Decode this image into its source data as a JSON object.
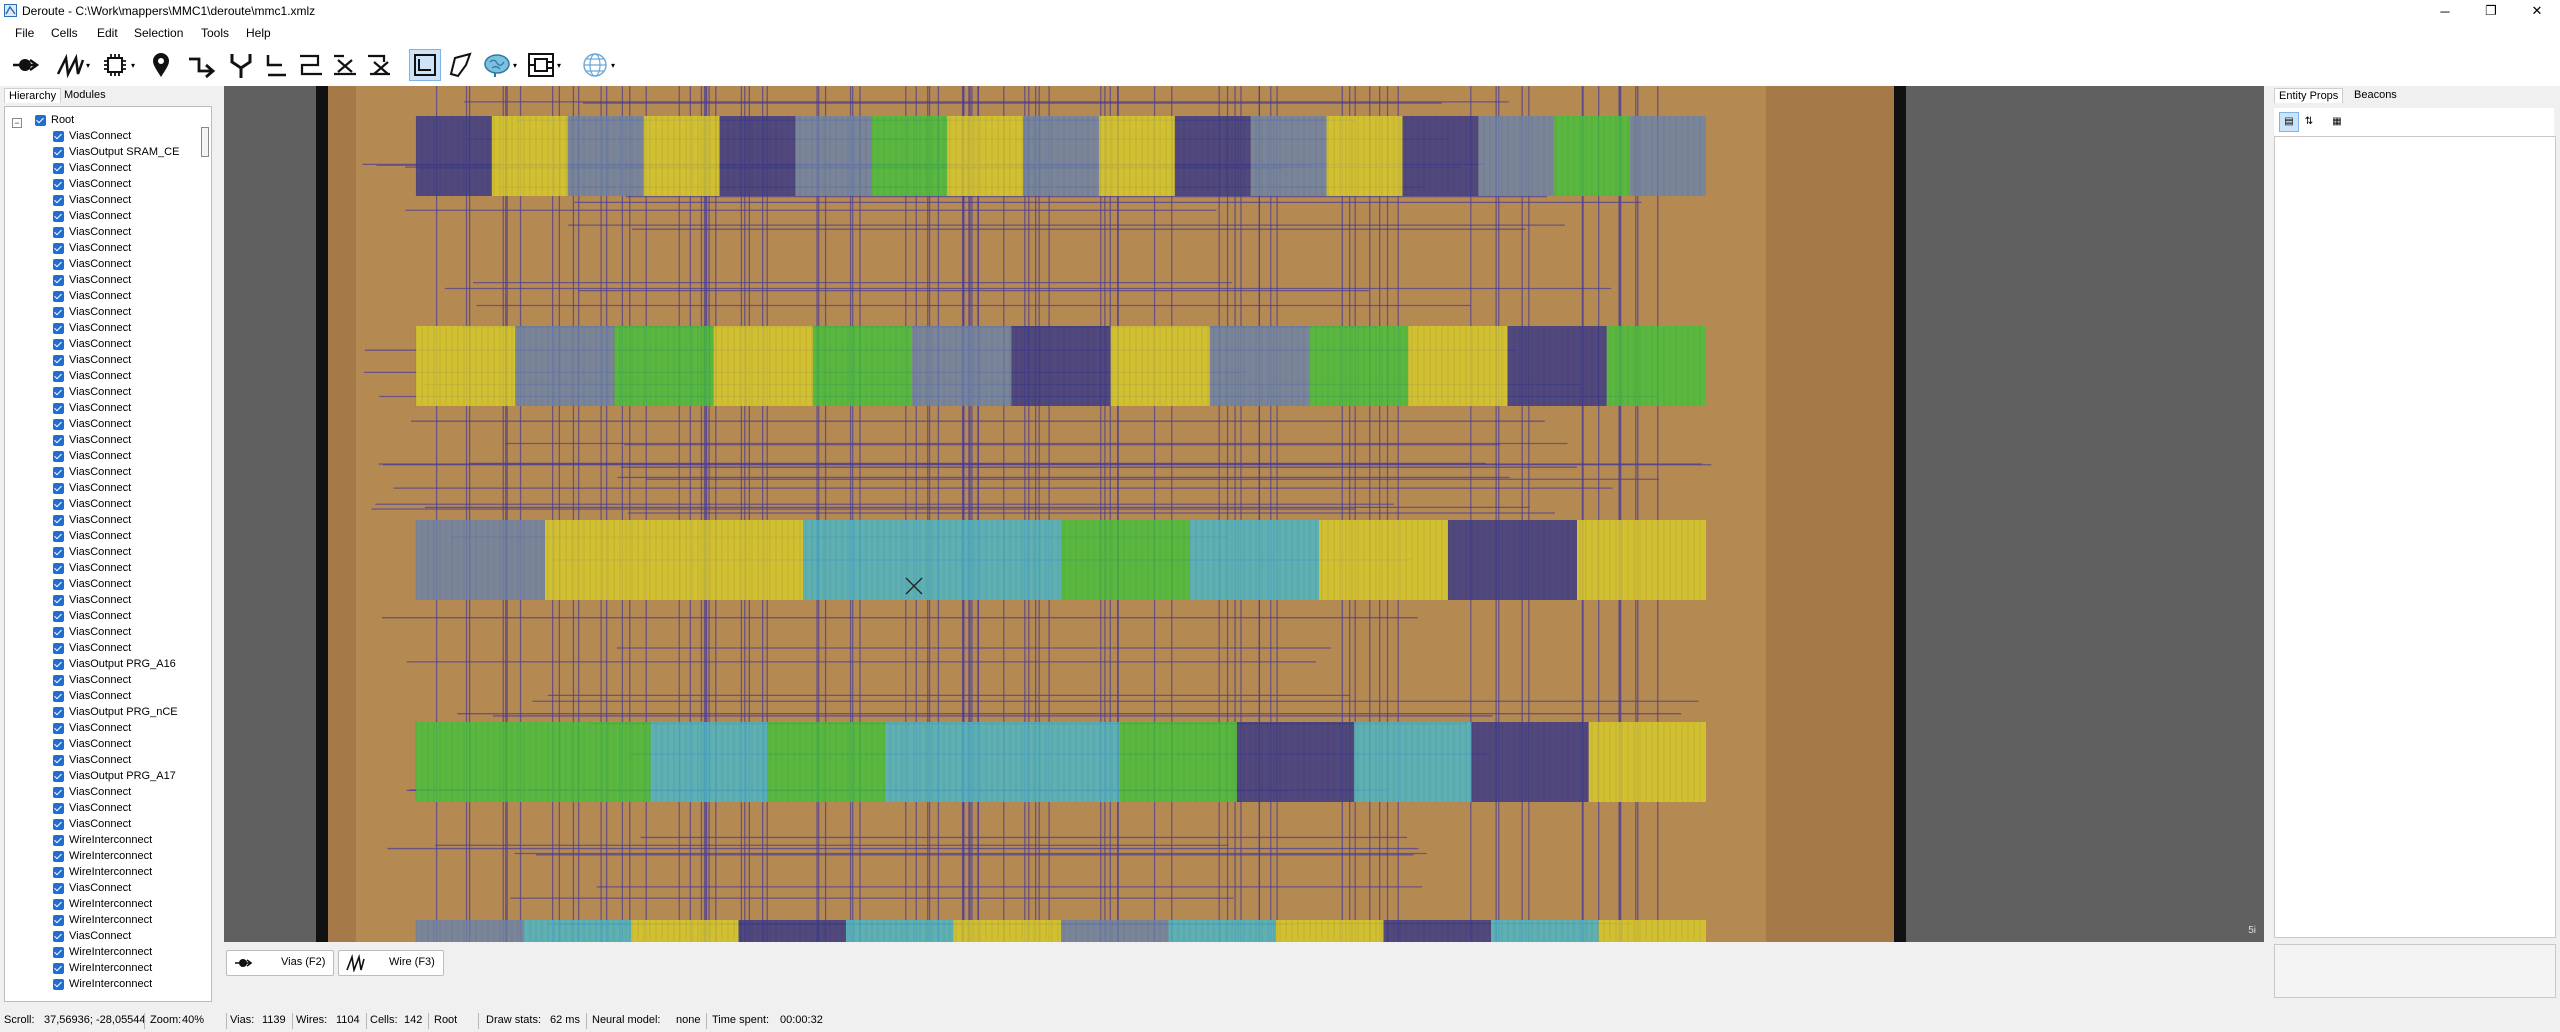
{
  "window": {
    "title": "Deroute - C:\\Work\\mappers\\MMC1\\deroute\\mmc1.xmlz",
    "controls": [
      "─",
      "❐",
      "✕"
    ]
  },
  "menu": [
    "File",
    "Cells",
    "Edit",
    "Selection",
    "Tools",
    "Help"
  ],
  "toolbar": {
    "tools": [
      "via-tool",
      "wire-tool",
      "cell-tool",
      "beacon-tool",
      "input-tool",
      "fork-tool",
      "wire-path-tool",
      "wire-path-2-tool",
      "wire-cross-tool",
      "wire-cross-2-tool",
      "region-select-tool",
      "polygon-tool",
      "neural-tool",
      "module-tool",
      "wireframe-tool"
    ]
  },
  "left_panel": {
    "tabs": [
      "Hierarchy",
      "Modules"
    ],
    "active_tab": "Hierarchy",
    "tree": {
      "root": "Root",
      "items": [
        "ViasConnect",
        "ViasOutput SRAM_CE",
        "ViasConnect",
        "ViasConnect",
        "ViasConnect",
        "ViasConnect",
        "ViasConnect",
        "ViasConnect",
        "ViasConnect",
        "ViasConnect",
        "ViasConnect",
        "ViasConnect",
        "ViasConnect",
        "ViasConnect",
        "ViasConnect",
        "ViasConnect",
        "ViasConnect",
        "ViasConnect",
        "ViasConnect",
        "ViasConnect",
        "ViasConnect",
        "ViasConnect",
        "ViasConnect",
        "ViasConnect",
        "ViasConnect",
        "ViasConnect",
        "ViasConnect",
        "ViasConnect",
        "ViasConnect",
        "ViasConnect",
        "ViasConnect",
        "ViasConnect",
        "ViasConnect",
        "ViasOutput PRG_A16",
        "ViasConnect",
        "ViasConnect",
        "ViasOutput PRG_nCE",
        "ViasConnect",
        "ViasConnect",
        "ViasConnect",
        "ViasOutput PRG_A17",
        "ViasConnect",
        "ViasConnect",
        "ViasConnect",
        "WireInterconnect",
        "WireInterconnect",
        "WireInterconnect",
        "ViasConnect",
        "WireInterconnect",
        "WireInterconnect",
        "ViasConnect",
        "WireInterconnect",
        "WireInterconnect",
        "WireInterconnect"
      ]
    }
  },
  "canvas": {
    "corner_label": "5i"
  },
  "bottom_tools": [
    {
      "icon": "via-icon",
      "label": "Vias (F2)"
    },
    {
      "icon": "wire-icon",
      "label": "Wire (F3)"
    }
  ],
  "right_panel": {
    "tabs": [
      "Entity Props",
      "Beacons"
    ],
    "active_tab": "Entity Props"
  },
  "status": {
    "scroll_label": "Scroll:",
    "scroll": "37,56936; -28,05544",
    "zoom_label": "Zoom:",
    "zoom": "40%",
    "vias_label": "Vias:",
    "vias": "1139",
    "wires_label": "Wires:",
    "wires": "1104",
    "cells_label": "Cells:",
    "cells": "142",
    "hierarchy": "Root",
    "draw_label": "Draw stats:",
    "draw": "62 ms",
    "neural_label": "Neural model:",
    "neural": "none",
    "time_label": "Time spent:",
    "time": "00:00:32"
  },
  "colors": {
    "die_background": "#b58a52",
    "cell_yellow": "#d8cc2c",
    "cell_green": "#46c23c",
    "cell_cyan": "#4ab8c8",
    "cell_slate": "#6d84a8",
    "cell_navy": "#3a3a86",
    "wire": "#4b3c94",
    "canvas_bg": "#606060"
  }
}
